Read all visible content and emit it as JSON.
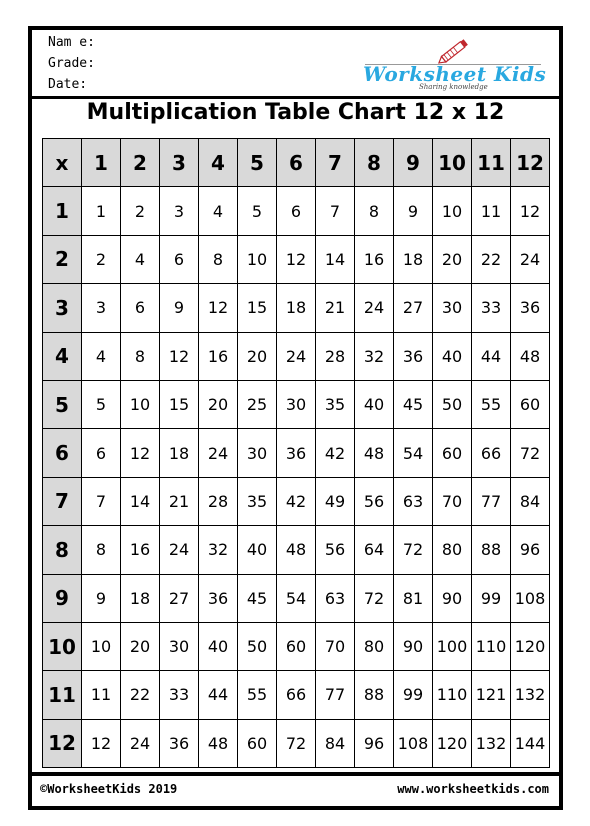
{
  "header": {
    "name_label": "Nam e:",
    "grade_label": "Grade:",
    "date_label": "Date:",
    "logo_text": "Worksheet Kids",
    "logo_tagline": "Sharing knowledge"
  },
  "title": "Multiplication Table Chart 12 x 12",
  "table": {
    "corner": "x",
    "columns": [
      "1",
      "2",
      "3",
      "4",
      "5",
      "6",
      "7",
      "8",
      "9",
      "10",
      "11",
      "12"
    ],
    "rows": [
      {
        "label": "1",
        "values": [
          1,
          2,
          3,
          4,
          5,
          6,
          7,
          8,
          9,
          10,
          11,
          12
        ]
      },
      {
        "label": "2",
        "values": [
          2,
          4,
          6,
          8,
          10,
          12,
          14,
          16,
          18,
          20,
          22,
          24
        ]
      },
      {
        "label": "3",
        "values": [
          3,
          6,
          9,
          12,
          15,
          18,
          21,
          24,
          27,
          30,
          33,
          36
        ]
      },
      {
        "label": "4",
        "values": [
          4,
          8,
          12,
          16,
          20,
          24,
          28,
          32,
          36,
          40,
          44,
          48
        ]
      },
      {
        "label": "5",
        "values": [
          5,
          10,
          15,
          20,
          25,
          30,
          35,
          40,
          45,
          50,
          55,
          60
        ]
      },
      {
        "label": "6",
        "values": [
          6,
          12,
          18,
          24,
          30,
          36,
          42,
          48,
          54,
          60,
          66,
          72
        ]
      },
      {
        "label": "7",
        "values": [
          7,
          14,
          21,
          28,
          35,
          42,
          49,
          56,
          63,
          70,
          77,
          84
        ]
      },
      {
        "label": "8",
        "values": [
          8,
          16,
          24,
          32,
          40,
          48,
          56,
          64,
          72,
          80,
          88,
          96
        ]
      },
      {
        "label": "9",
        "values": [
          9,
          18,
          27,
          36,
          45,
          54,
          63,
          72,
          81,
          90,
          99,
          108
        ]
      },
      {
        "label": "10",
        "values": [
          10,
          20,
          30,
          40,
          50,
          60,
          70,
          80,
          90,
          100,
          110,
          120
        ]
      },
      {
        "label": "11",
        "values": [
          11,
          22,
          33,
          44,
          55,
          66,
          77,
          88,
          99,
          110,
          121,
          132
        ]
      },
      {
        "label": "12",
        "values": [
          12,
          24,
          36,
          48,
          60,
          72,
          84,
          96,
          108,
          120,
          132,
          144
        ]
      }
    ]
  },
  "footer": {
    "copyright": "©WorksheetKids 2019",
    "url": "www.worksheetkids.com"
  },
  "colors": {
    "header_cell_bg": "#d9d9d9",
    "logo_blue": "#29a8e0",
    "pencil_red": "#c0272d"
  }
}
